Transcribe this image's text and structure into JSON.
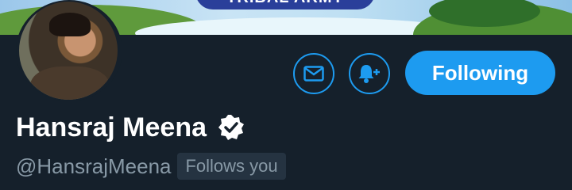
{
  "banner": {
    "text": "TRIBAL ARMY"
  },
  "profile": {
    "display_name": "Hansraj Meena",
    "handle": "@HansrajMeena",
    "follows_you_badge": "Follows you",
    "verified": true
  },
  "actions": {
    "message_icon": "envelope-icon",
    "notify_icon": "bell-plus-icon",
    "follow_label": "Following"
  },
  "colors": {
    "background": "#15202b",
    "accent": "#1d9bf0",
    "primary_text": "#ffffff",
    "secondary_text": "#8899a6"
  }
}
